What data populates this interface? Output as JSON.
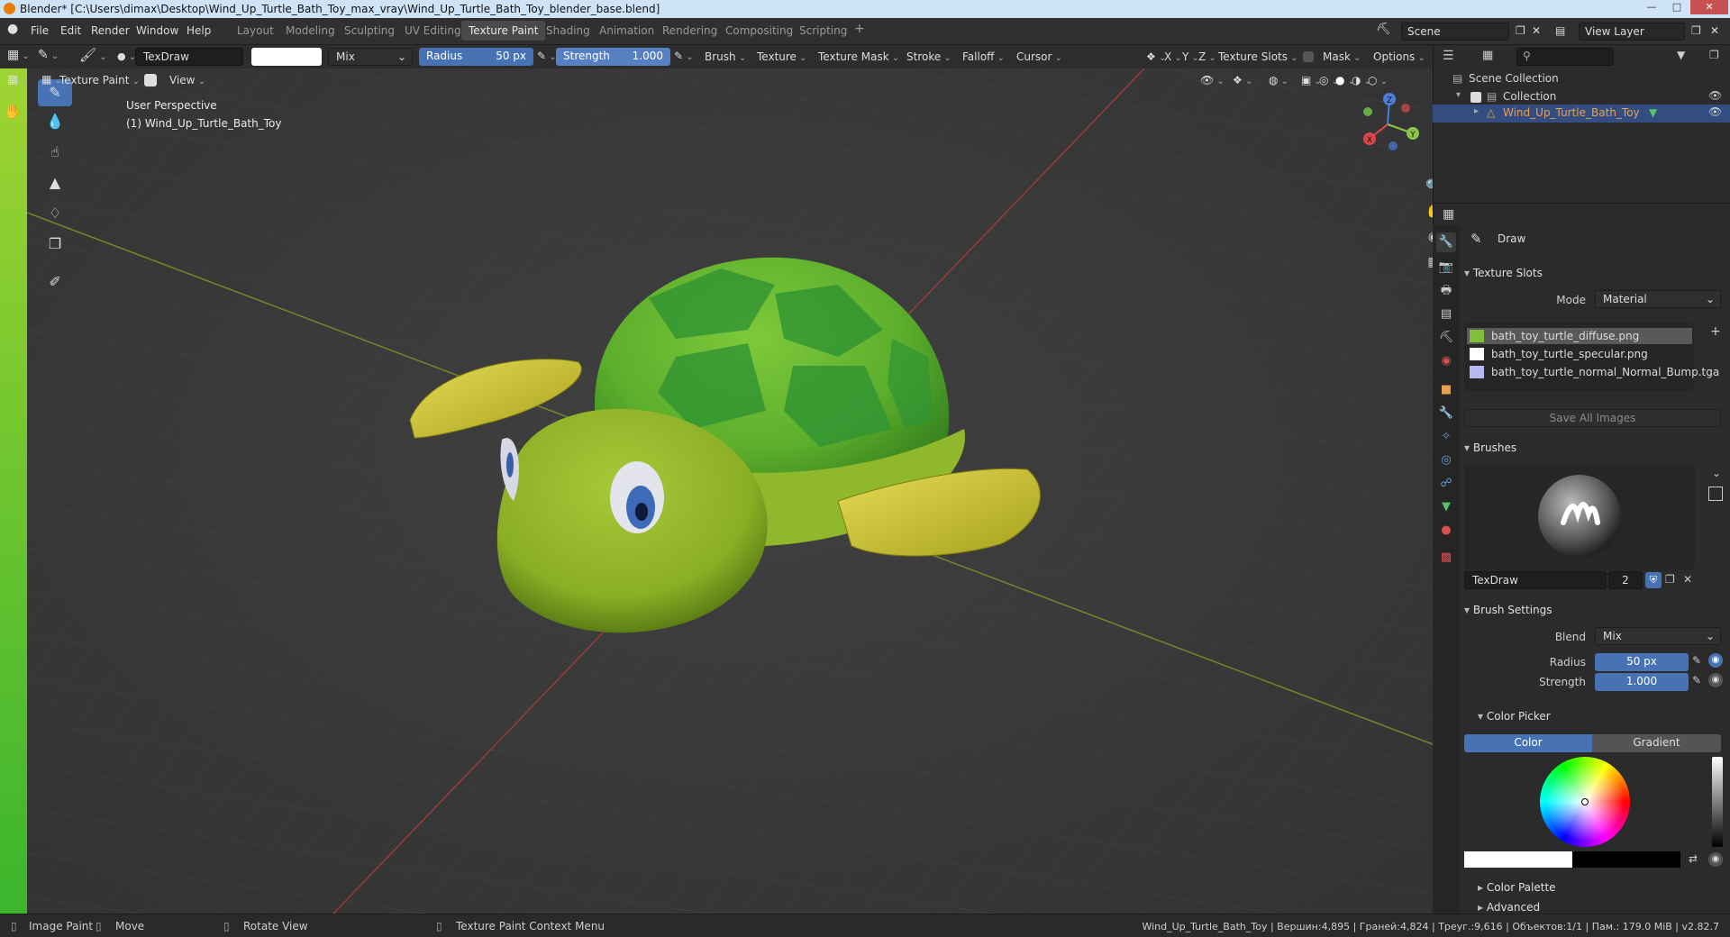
{
  "window": {
    "title": "Blender* [C:\\Users\\dimax\\Desktop\\Wind_Up_Turtle_Bath_Toy_max_vray\\Wind_Up_Turtle_Bath_Toy_blender_base.blend]"
  },
  "menu": [
    "File",
    "Edit",
    "Render",
    "Window",
    "Help"
  ],
  "workspaces": [
    "Layout",
    "Modeling",
    "Sculpting",
    "UV Editing",
    "Texture Paint",
    "Shading",
    "Animation",
    "Rendering",
    "Compositing",
    "Scripting",
    "+"
  ],
  "active_workspace": "Texture Paint",
  "scene": {
    "name": "Scene",
    "view_layer": "View Layer"
  },
  "tool_header": {
    "brush_name": "TexDraw",
    "blend": "Mix",
    "radius_label": "Radius",
    "radius_value": "50 px",
    "strength_label": "Strength",
    "strength_value": "1.000",
    "menus": [
      "Brush",
      "Texture",
      "Texture Mask",
      "Stroke",
      "Falloff",
      "Cursor"
    ],
    "axes": [
      "X",
      "Y",
      "Z"
    ],
    "texture_slots": "Texture Slots",
    "mask": "Mask",
    "options": "Options"
  },
  "viewport_header": {
    "mode": "Texture Paint",
    "view": "View"
  },
  "viewport": {
    "perspective": "User Perspective",
    "object": "(1) Wind_Up_Turtle_Bath_Toy",
    "gizmo_axes": [
      "X",
      "Y",
      "Z"
    ]
  },
  "outliner": {
    "scene_collection": "Scene Collection",
    "collection": "Collection",
    "object": "Wind_Up_Turtle_Bath_Toy"
  },
  "properties": {
    "tool_name": "Draw",
    "texture_slots_title": "Texture Slots",
    "mode_label": "Mode",
    "mode_value": "Material",
    "slots": [
      {
        "name": "bath_toy_turtle_diffuse.png",
        "color": "#7fbf3a",
        "selected": true
      },
      {
        "name": "bath_toy_turtle_specular.png",
        "color": "#ffffff",
        "selected": false
      },
      {
        "name": "bath_toy_turtle_normal_Normal_Bump.tga",
        "color": "#b8b8f0",
        "selected": false
      }
    ],
    "save_all": "Save All Images",
    "brushes_title": "Brushes",
    "brush_name": "TexDraw",
    "brush_users": "2",
    "brush_settings_title": "Brush Settings",
    "blend_label": "Blend",
    "blend_value": "Mix",
    "radius_label": "Radius",
    "radius_value": "50 px",
    "strength_label": "Strength",
    "strength_value": "1.000",
    "color_picker_title": "Color Picker",
    "tab_color": "Color",
    "tab_gradient": "Gradient",
    "color_palette": "Color Palette",
    "advanced": "Advanced"
  },
  "status": {
    "items": [
      "Image Paint",
      "Move",
      "Rotate View",
      "Texture Paint Context Menu"
    ],
    "stats": "Wind_Up_Turtle_Bath_Toy | Вершин:4,895 | Граней:4,824 | Треуг.:9,616 | Объектов:1/1 | Пам.: 179.0 MiB | v2.82.7"
  },
  "colors": {
    "accent": "#4772b3",
    "turtle_body": "#8fb02a",
    "turtle_shell": "#3e9a2a",
    "flipper": "#c4c02a"
  }
}
